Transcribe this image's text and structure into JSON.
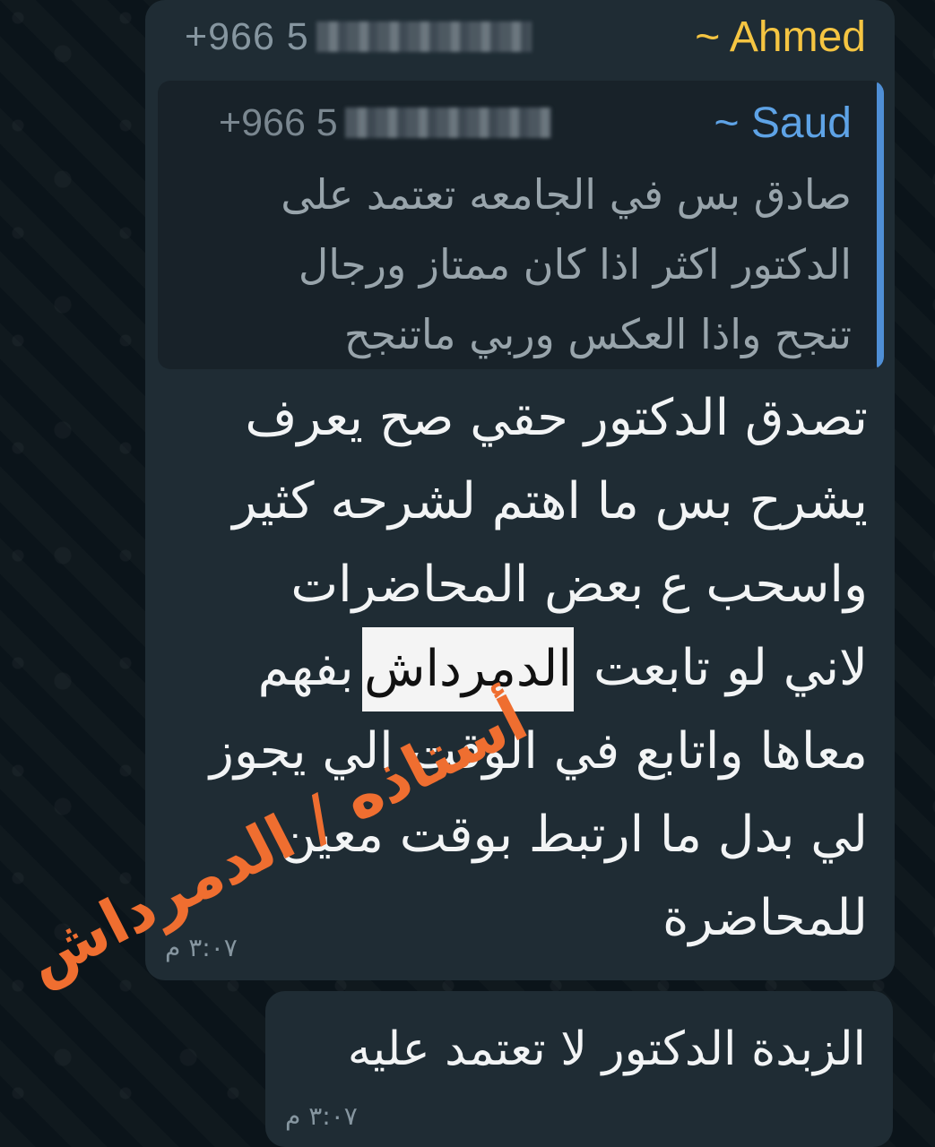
{
  "chat": {
    "messages": [
      {
        "sender_name": "~ Ahmed",
        "sender_phone": "+966 5",
        "reply": {
          "name": "~ Saud",
          "phone": "+966 5",
          "text": "صادق بس في الجامعه تعتمد على\nالدكتور اكثر اذا كان ممتاز ورجال\nتنجح واذا العكس وربي ماتنجح"
        },
        "text": "تصدق الدكتور حقي صح يعرف\nيشرح بس ما اهتم لشرحه كثير\nواسحب ع بعض المحاضرات\nلاني لو تابعت الدمرداش بفهم\nمعاها واتابع في الوقت الي يجوز\nلي بدل ما ارتبط بوقت معين\nللمحاضرة",
        "highlight": "الدمرداش",
        "time": "٣:٠٧ م"
      },
      {
        "text": "الزبدة الدكتور لا تعتمد عليه",
        "time": "٣:٠٧ م"
      }
    ],
    "overlay_text": "أستاذه / الدمرداش",
    "colors": {
      "background": "#0b141a",
      "bubble": "#1f2c34",
      "sender_name": "#f5c542",
      "quote_name": "#5ea3e6",
      "quote_bar": "#4f8fd6",
      "overlay": "#ef6e30"
    }
  }
}
